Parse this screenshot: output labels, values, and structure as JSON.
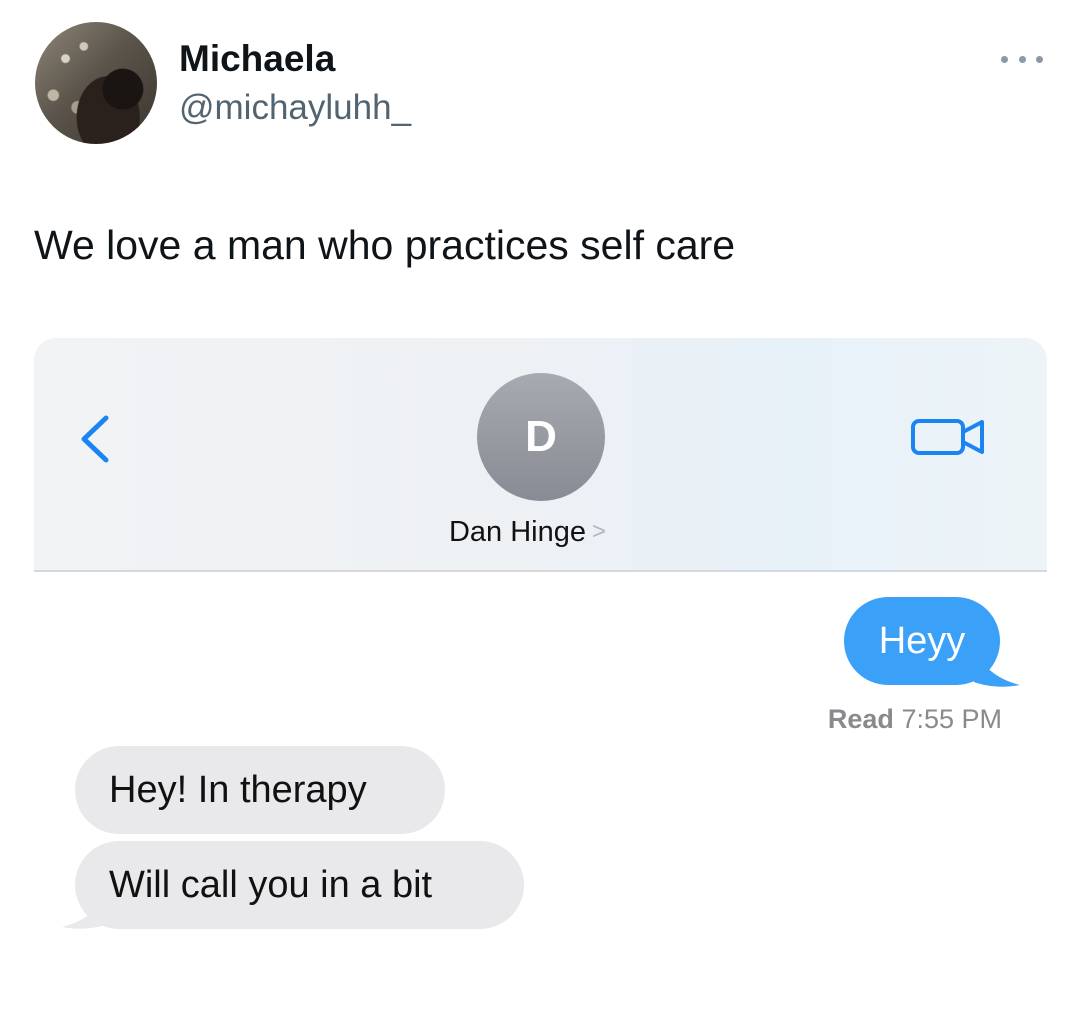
{
  "tweet": {
    "display_name": "Michaela",
    "handle": "@michayluhh_",
    "text": "We love a man who practices self care",
    "avatar_icon": "profile-photo",
    "more_icon": "ellipsis-icon"
  },
  "conversation": {
    "contact_initial": "D",
    "contact_name": "Dan Hinge",
    "contact_chevron": ">",
    "back_icon": "chevron-left-icon",
    "video_icon": "video-camera-icon",
    "accent_color": "#3ba0f8",
    "messages": {
      "sent": {
        "text": "Heyy"
      },
      "read_label": "Read",
      "read_time": "7:55 PM",
      "received": [
        {
          "text": "Hey! In therapy"
        },
        {
          "text": "Will call you in a bit"
        }
      ]
    }
  }
}
